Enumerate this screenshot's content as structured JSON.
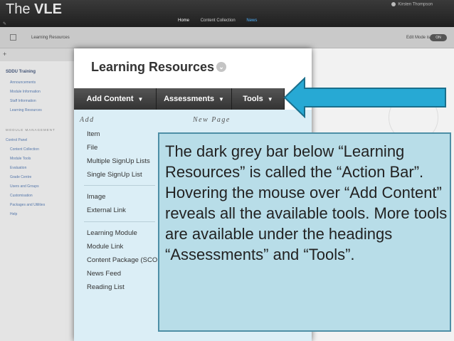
{
  "app": {
    "brand_prefix": "The ",
    "brand_name": "VLE",
    "user": "Kirsten Thompson"
  },
  "top_nav": {
    "home": "Home",
    "content_collection": "Content Collection",
    "third": "News"
  },
  "breadcrumb": {
    "current": "Learning Resources",
    "edit_mode_label": "Edit Mode is:",
    "edit_mode_value": "ON"
  },
  "sidebar": {
    "course": "SDDU Training",
    "items": [
      "Announcements",
      "Module Information",
      "Staff Information",
      "Learning Resources"
    ],
    "section_heading": "MODULE MANAGEMENT",
    "control_panel": "Control Panel",
    "control_items": [
      "Content Collection",
      "Module Tools",
      "Evaluation",
      "Grade Centre",
      "Users and Groups",
      "Customisation",
      "Packages and Utilities",
      "Help"
    ]
  },
  "page": {
    "title": "Learning Resources"
  },
  "action_bar": {
    "add_content": "Add Content",
    "assessments": "Assessments",
    "tools": "Tools"
  },
  "menu": {
    "add_heading": "Add",
    "new_page_heading": "New Page",
    "items": [
      "Item",
      "File",
      "Multiple SignUp Lists",
      "Single SignUp List",
      "Image",
      "External Link",
      "Learning Module",
      "Module Link",
      "Content Package (SCORM)",
      "News Feed",
      "Reading List"
    ]
  },
  "callout": {
    "text": "The dark grey bar below “Learning Resources” is called the “Action Bar”. Hovering the mouse over “Add Content” reveals all the available tools. More tools are available under the headings “Assessments” and “Tools”."
  },
  "colors": {
    "action_bar": "#444444",
    "menu_bg": "#dbeef6",
    "callout_bg": "#b8dde8",
    "callout_border": "#4e8fa6",
    "arrow": "#27a9d4"
  },
  "icons": {
    "title_menu": "chevron-down-icon",
    "pointer": "arrow-left-icon"
  }
}
